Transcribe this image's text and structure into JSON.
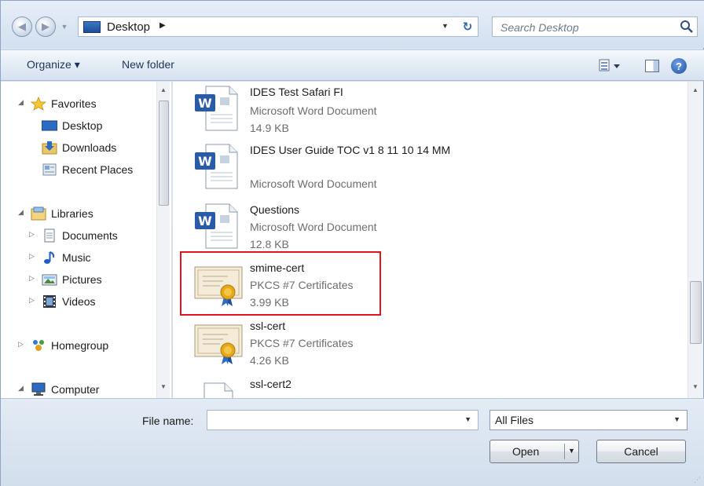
{
  "address_bar": {
    "location": "Desktop",
    "search_placeholder": "Search Desktop"
  },
  "toolbar": {
    "organize_label": "Organize ▾",
    "new_folder_label": "New folder"
  },
  "nav_pane": {
    "favorites": "Favorites",
    "favorites_items": [
      "Desktop",
      "Downloads",
      "Recent Places"
    ],
    "libraries": "Libraries",
    "library_items": [
      "Documents",
      "Music",
      "Pictures",
      "Videos"
    ],
    "homegroup": "Homegroup",
    "computer": "Computer"
  },
  "files": [
    {
      "name": "IDES Test Safari FI",
      "type": "Microsoft Word Document",
      "size": "14.9 KB",
      "icon": "word-doc-icon"
    },
    {
      "name": "IDES User Guide TOC v1 8 11 10 14 MM",
      "type": "Microsoft Word Document",
      "size": "",
      "icon": "word-doc-icon"
    },
    {
      "name": "Questions",
      "type": "Microsoft Word Document",
      "size": "12.8 KB",
      "icon": "word-doc-icon"
    },
    {
      "name": "smime-cert",
      "type": "PKCS #7 Certificates",
      "size": "3.99 KB",
      "icon": "certificate-icon",
      "highlighted": true
    },
    {
      "name": "ssl-cert",
      "type": "PKCS #7 Certificates",
      "size": "4.26 KB",
      "icon": "certificate-icon"
    },
    {
      "name": "ssl-cert2",
      "type": "",
      "size": "",
      "icon": "blank-file-icon"
    }
  ],
  "bottom": {
    "file_name_label": "File name:",
    "file_name_value": "",
    "filter_value": "All Files",
    "open_label": "Open",
    "cancel_label": "Cancel"
  },
  "colors": {
    "highlight": "#e3141b",
    "accent": "#1e4d98"
  }
}
